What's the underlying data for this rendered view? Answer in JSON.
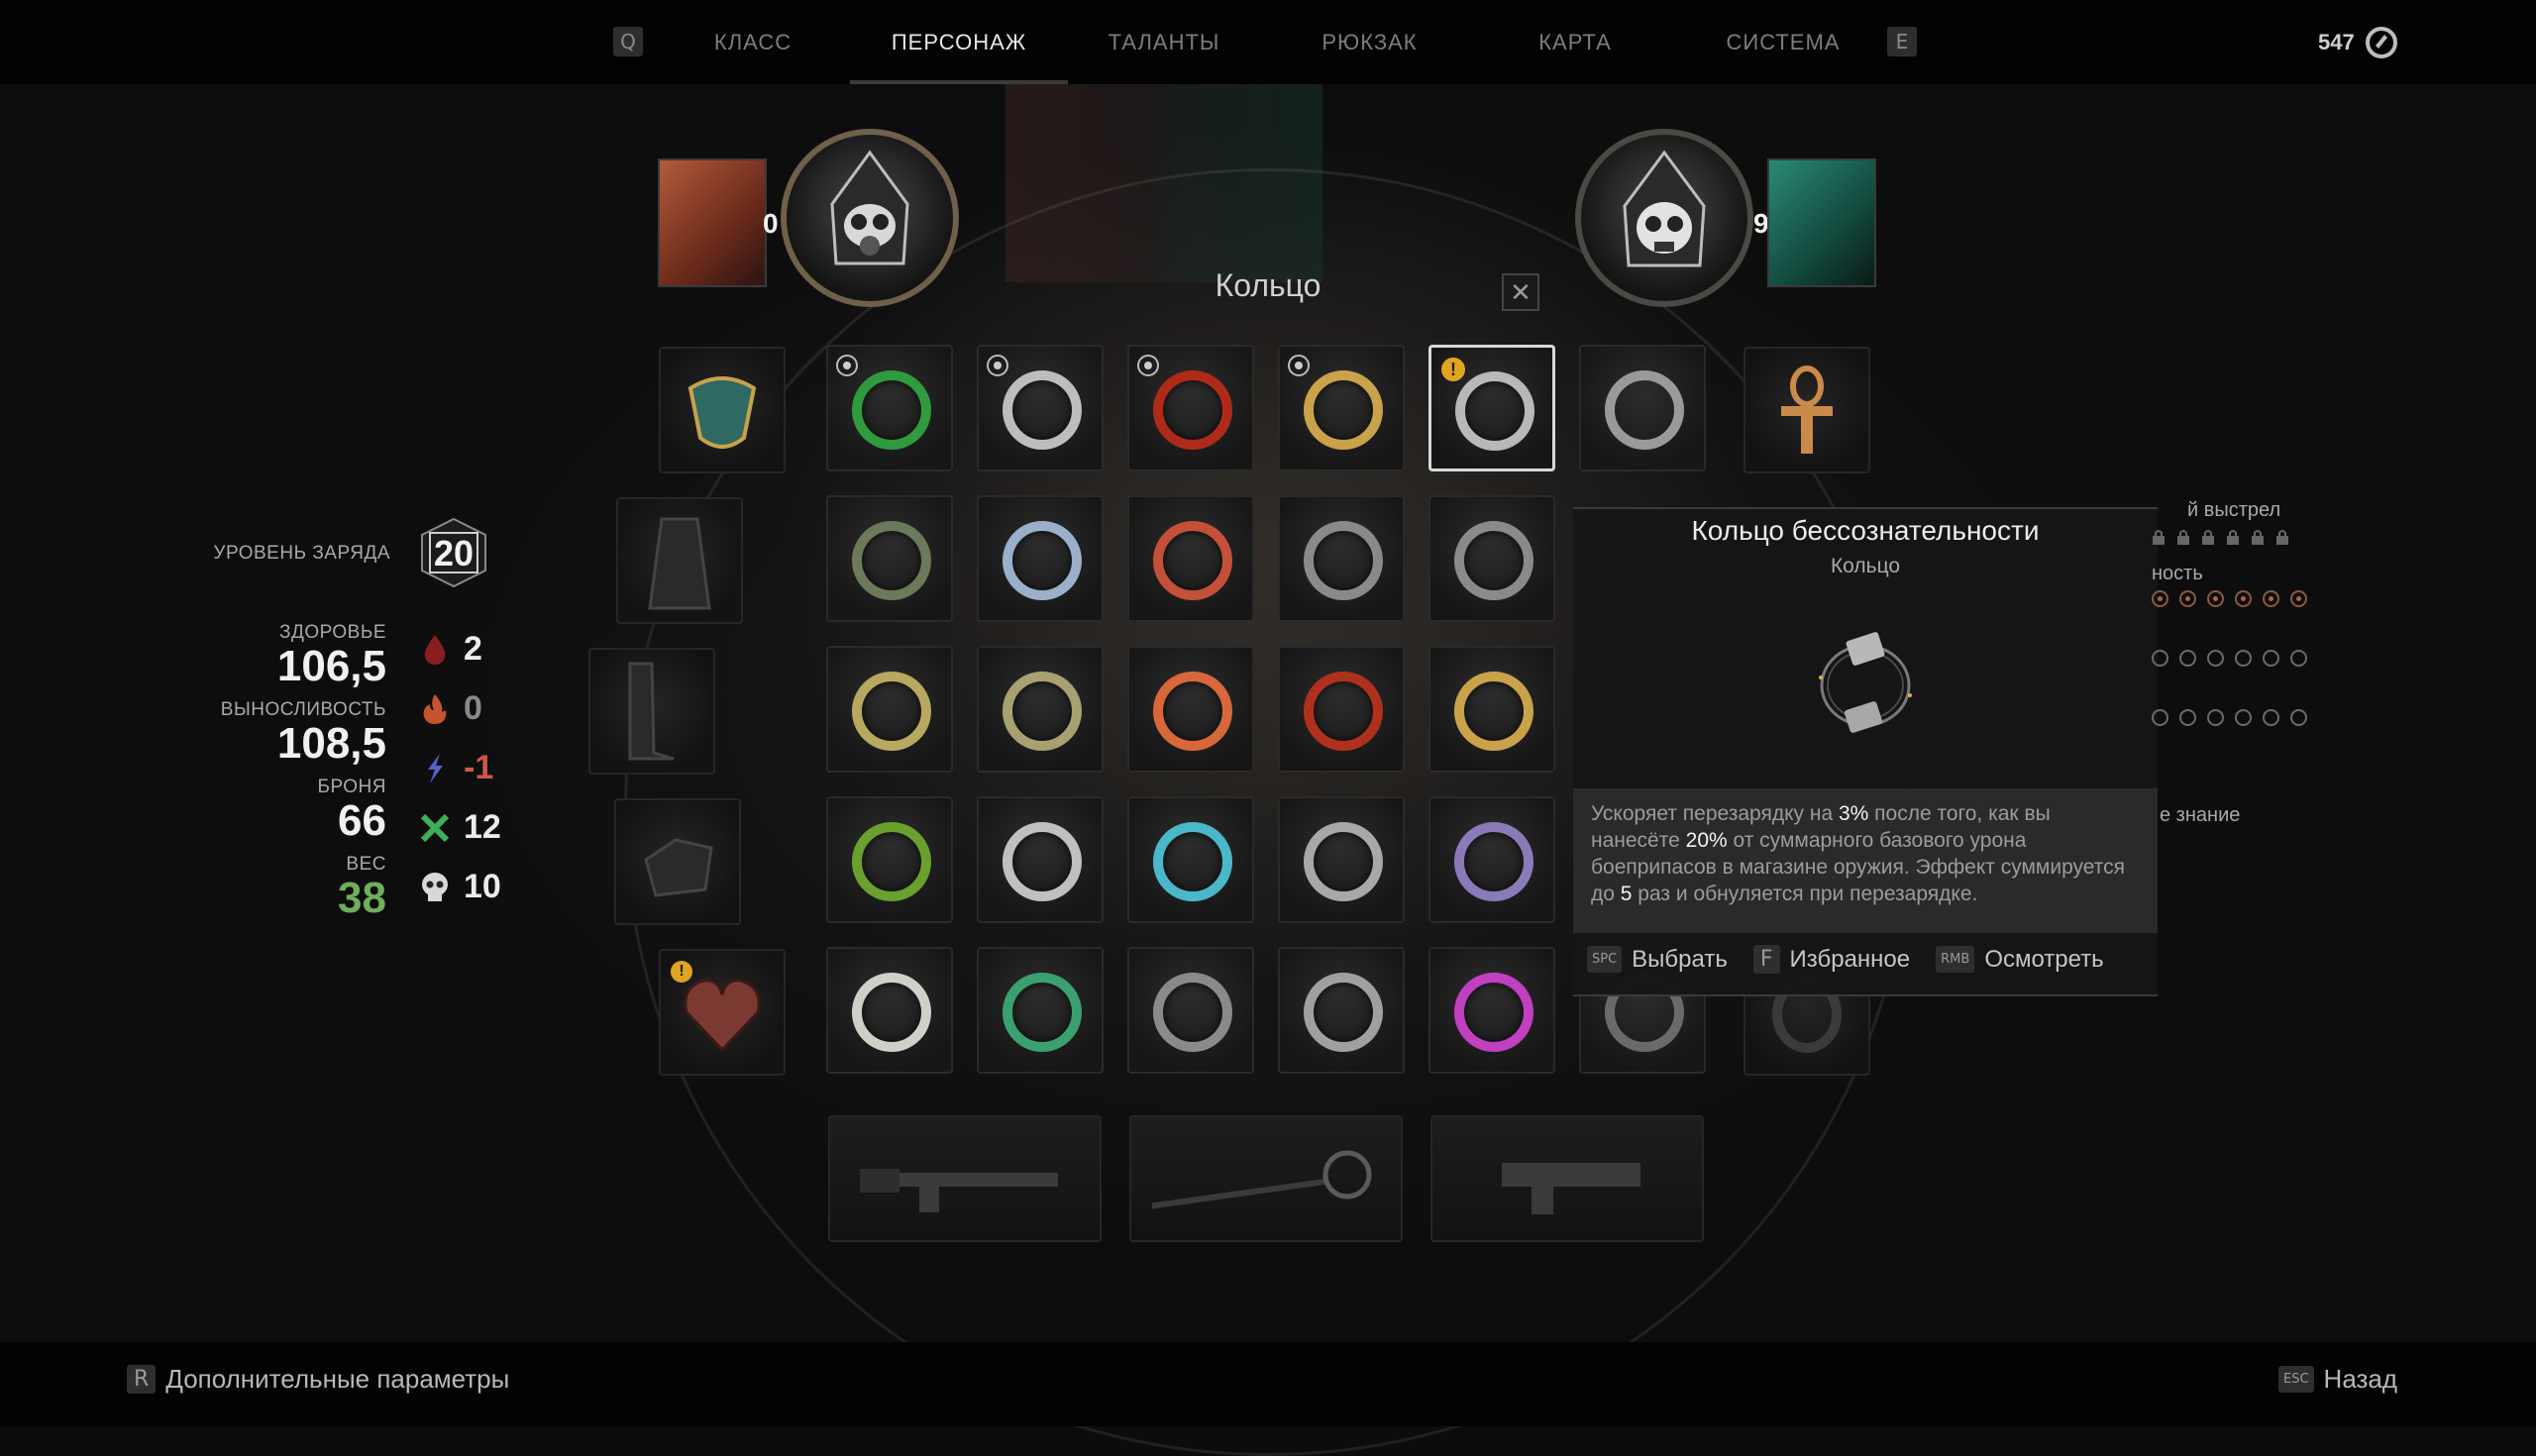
{
  "nav": {
    "left_key": "Q",
    "right_key": "E",
    "tabs": [
      {
        "label": "КЛАСС",
        "active": false
      },
      {
        "label": "ПЕРСОНАЖ",
        "active": true
      },
      {
        "label": "ТАЛАНТЫ",
        "active": false
      },
      {
        "label": "РЮКЗАК",
        "active": false
      },
      {
        "label": "КАРТА",
        "active": false
      },
      {
        "label": "СИСТЕМА",
        "active": false
      }
    ],
    "currency_value": "547"
  },
  "archetypes": {
    "primary_level": "0",
    "secondary_level": "9"
  },
  "popup": {
    "title": "Кольцо",
    "close_glyph": "✕"
  },
  "stats": {
    "charge_label": "УРОВЕНЬ ЗАРЯДА",
    "charge_value": "20",
    "health_label": "ЗДОРОВЬЕ",
    "health_value": "106,5",
    "stamina_label": "ВЫНОСЛИВОСТЬ",
    "stamina_value": "108,5",
    "armor_label": "БРОНЯ",
    "armor_value": "66",
    "weight_label": "ВЕС",
    "weight_value": "38",
    "weight_color": "#6fae5a"
  },
  "resistances": [
    {
      "icon": "blood-drop-icon",
      "value": "2",
      "color": "#ececec"
    },
    {
      "icon": "fire-icon",
      "value": "0",
      "color": "#8a8a8a"
    },
    {
      "icon": "lightning-icon",
      "value": "-1",
      "color": "#d0564a"
    },
    {
      "icon": "acid-icon",
      "value": "12",
      "color": "#ececec"
    },
    {
      "icon": "skull-icon",
      "value": "10",
      "color": "#ececec"
    }
  ],
  "tooltip": {
    "title": "Кольцо бессознательности",
    "subtitle": "Кольцо",
    "desc_1": "Ускоряет перезарядку на ",
    "desc_v1": "3%",
    "desc_2": " после того, как вы нанесёте ",
    "desc_v2": "20%",
    "desc_3": " от суммарного базового урона боеприпасов в магазине оружия. Эффект суммируется до ",
    "desc_v3": "5",
    "desc_4": " раз и обнуляется при перезарядке.",
    "actions": [
      {
        "key": "SPC",
        "label": "Выбрать"
      },
      {
        "key": "F",
        "label": "Избранное"
      },
      {
        "key": "RMB",
        "label": "Осмотреть"
      }
    ]
  },
  "side_cut": {
    "line1": "й выстрел",
    "line2": "ность",
    "line3": "е знание"
  },
  "bottom": {
    "left_key": "R",
    "left_label": "Дополнительные параметры",
    "right_key": "ESC",
    "right_label": "Назад"
  },
  "colors": {
    "accent_gold": "#c9a24a",
    "warning": "#e0a51e",
    "highlight_text": "#f2f2f2"
  }
}
